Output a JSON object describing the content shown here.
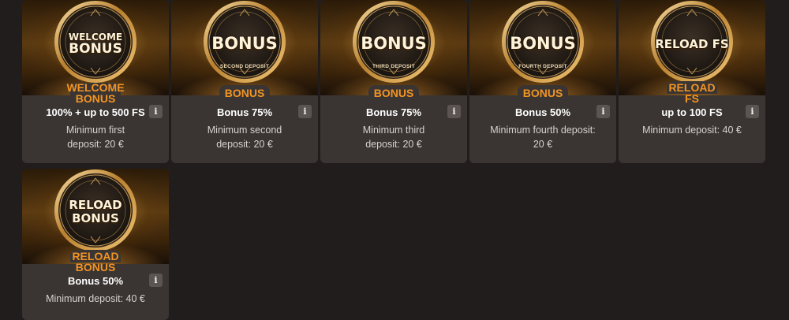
{
  "colors": {
    "background": "#211d1d",
    "card": "#3a3533",
    "accent": "#f39422",
    "info_button": "#5b5451"
  },
  "bonuses": [
    {
      "coin_line1": "WELCOME",
      "coin_line2": "BONUS",
      "coin_sub": "",
      "label_line1": "WELCOME",
      "label_line2": "BONUS",
      "amount": "100% + up to 500 FS",
      "desc_line1": "Minimum first",
      "desc_line2": "deposit: 20 €",
      "info_icon": "i"
    },
    {
      "coin_line1": "BONUS",
      "coin_sub": "SECOND DEPOSIT",
      "label_line1": "BONUS",
      "amount": "Bonus 75%",
      "desc_line1": "Minimum second",
      "desc_line2": "deposit: 20 €",
      "info_icon": "i"
    },
    {
      "coin_line1": "BONUS",
      "coin_sub": "THIRD DEPOSIT",
      "label_line1": "BONUS",
      "amount": "Bonus 75%",
      "desc_line1": "Minimum third",
      "desc_line2": "deposit: 20 €",
      "info_icon": "i"
    },
    {
      "coin_line1": "BONUS",
      "coin_sub": "FOURTH DEPOSIT",
      "label_line1": "BONUS",
      "amount": "Bonus 50%",
      "desc_line1": "Minimum fourth deposit:",
      "desc_line2": "20 €",
      "info_icon": "i"
    },
    {
      "coin_line1": "RELOAD FS",
      "coin_sub": "",
      "label_line1": "RELOAD",
      "label_line2": "FS",
      "amount": "up to 100 FS",
      "desc_line1": "Minimum deposit: 40 €",
      "info_icon": "i"
    },
    {
      "coin_line1": "RELOAD",
      "coin_line2": "BONUS",
      "coin_sub": "",
      "label_line1": "RELOAD",
      "label_line2": "BONUS",
      "amount": "Bonus 50%",
      "desc_line1": "Minimum deposit: 40 €",
      "info_icon": "i"
    }
  ]
}
